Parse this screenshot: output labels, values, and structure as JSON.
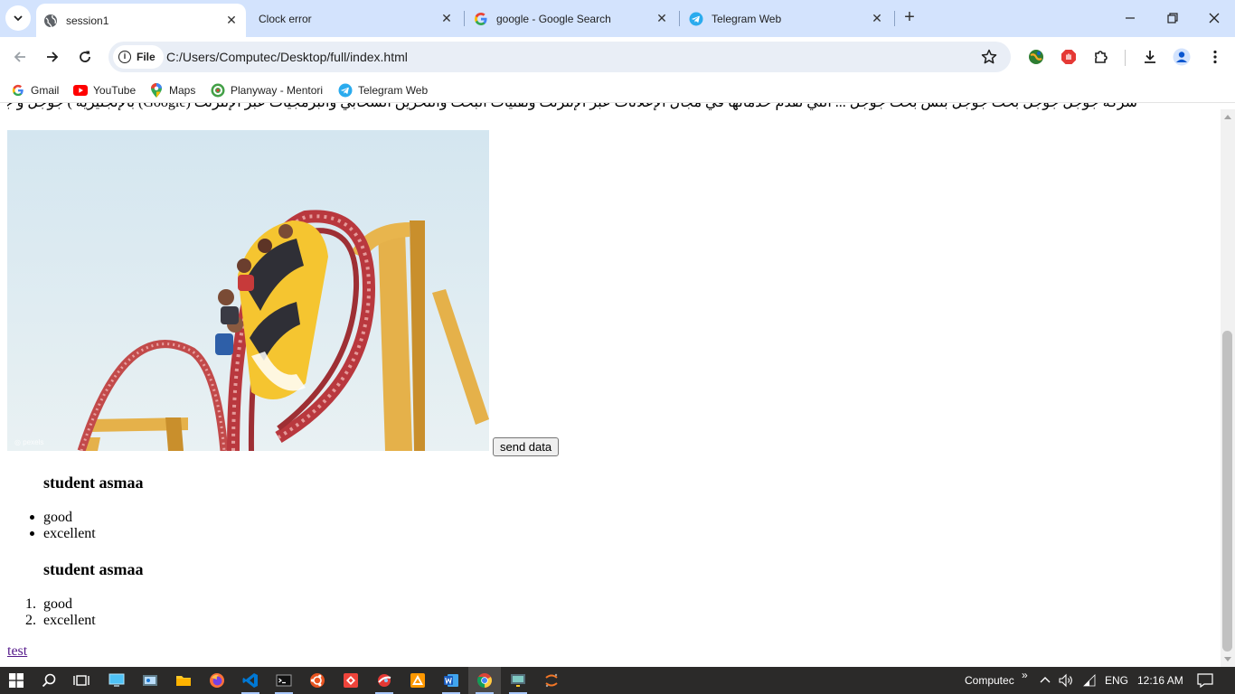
{
  "browser": {
    "tabs": [
      {
        "title": "session1",
        "active": true,
        "icon": "globe-icon"
      },
      {
        "title": "Clock error",
        "active": false,
        "icon": "none"
      },
      {
        "title": "google - Google Search",
        "active": false,
        "icon": "google-icon"
      },
      {
        "title": "Telegram Web",
        "active": false,
        "icon": "telegram-icon"
      }
    ],
    "address": {
      "chip_label": "File",
      "url": "C:/Users/Computec/Desktop/full/index.html"
    },
    "bookmarks": [
      {
        "label": "Gmail",
        "icon": "google-icon"
      },
      {
        "label": "YouTube",
        "icon": "youtube-icon"
      },
      {
        "label": "Maps",
        "icon": "maps-icon"
      },
      {
        "label": "Planyway - Mentori",
        "icon": "planyway-icon"
      },
      {
        "label": "Telegram Web",
        "icon": "telegram-icon"
      }
    ]
  },
  "page": {
    "arabic_text": "شركة جوجل جوجل بحث جوجل بلس بحث جوجل ... التي تقدم خدماتها في مجال الإعلانات عبر الإنترنت وتقنيات البحث والتخزين السحابي والبرمجيات عبر الإنترنت (Google) بالإنجليزية ) جوجل و جوجل و جوجل",
    "image_alt": "roller coaster",
    "button_label": "send data",
    "unordered_section": {
      "heading": "student asmaa",
      "items": [
        "good",
        "excellent"
      ]
    },
    "ordered_section": {
      "heading": "student asmaa",
      "items": [
        "good",
        "excellent"
      ],
      "markers": [
        "1.",
        "2."
      ]
    },
    "link_label": "test"
  },
  "taskbar": {
    "user": "Computec",
    "language": "ENG",
    "time": "12:16 AM",
    "overflow": "»"
  },
  "colors": {
    "tabstrip": "#d3e3fd",
    "omnibox": "#e9eef6",
    "link_visited": "#551a8b",
    "taskbar": "#2b2a29"
  }
}
